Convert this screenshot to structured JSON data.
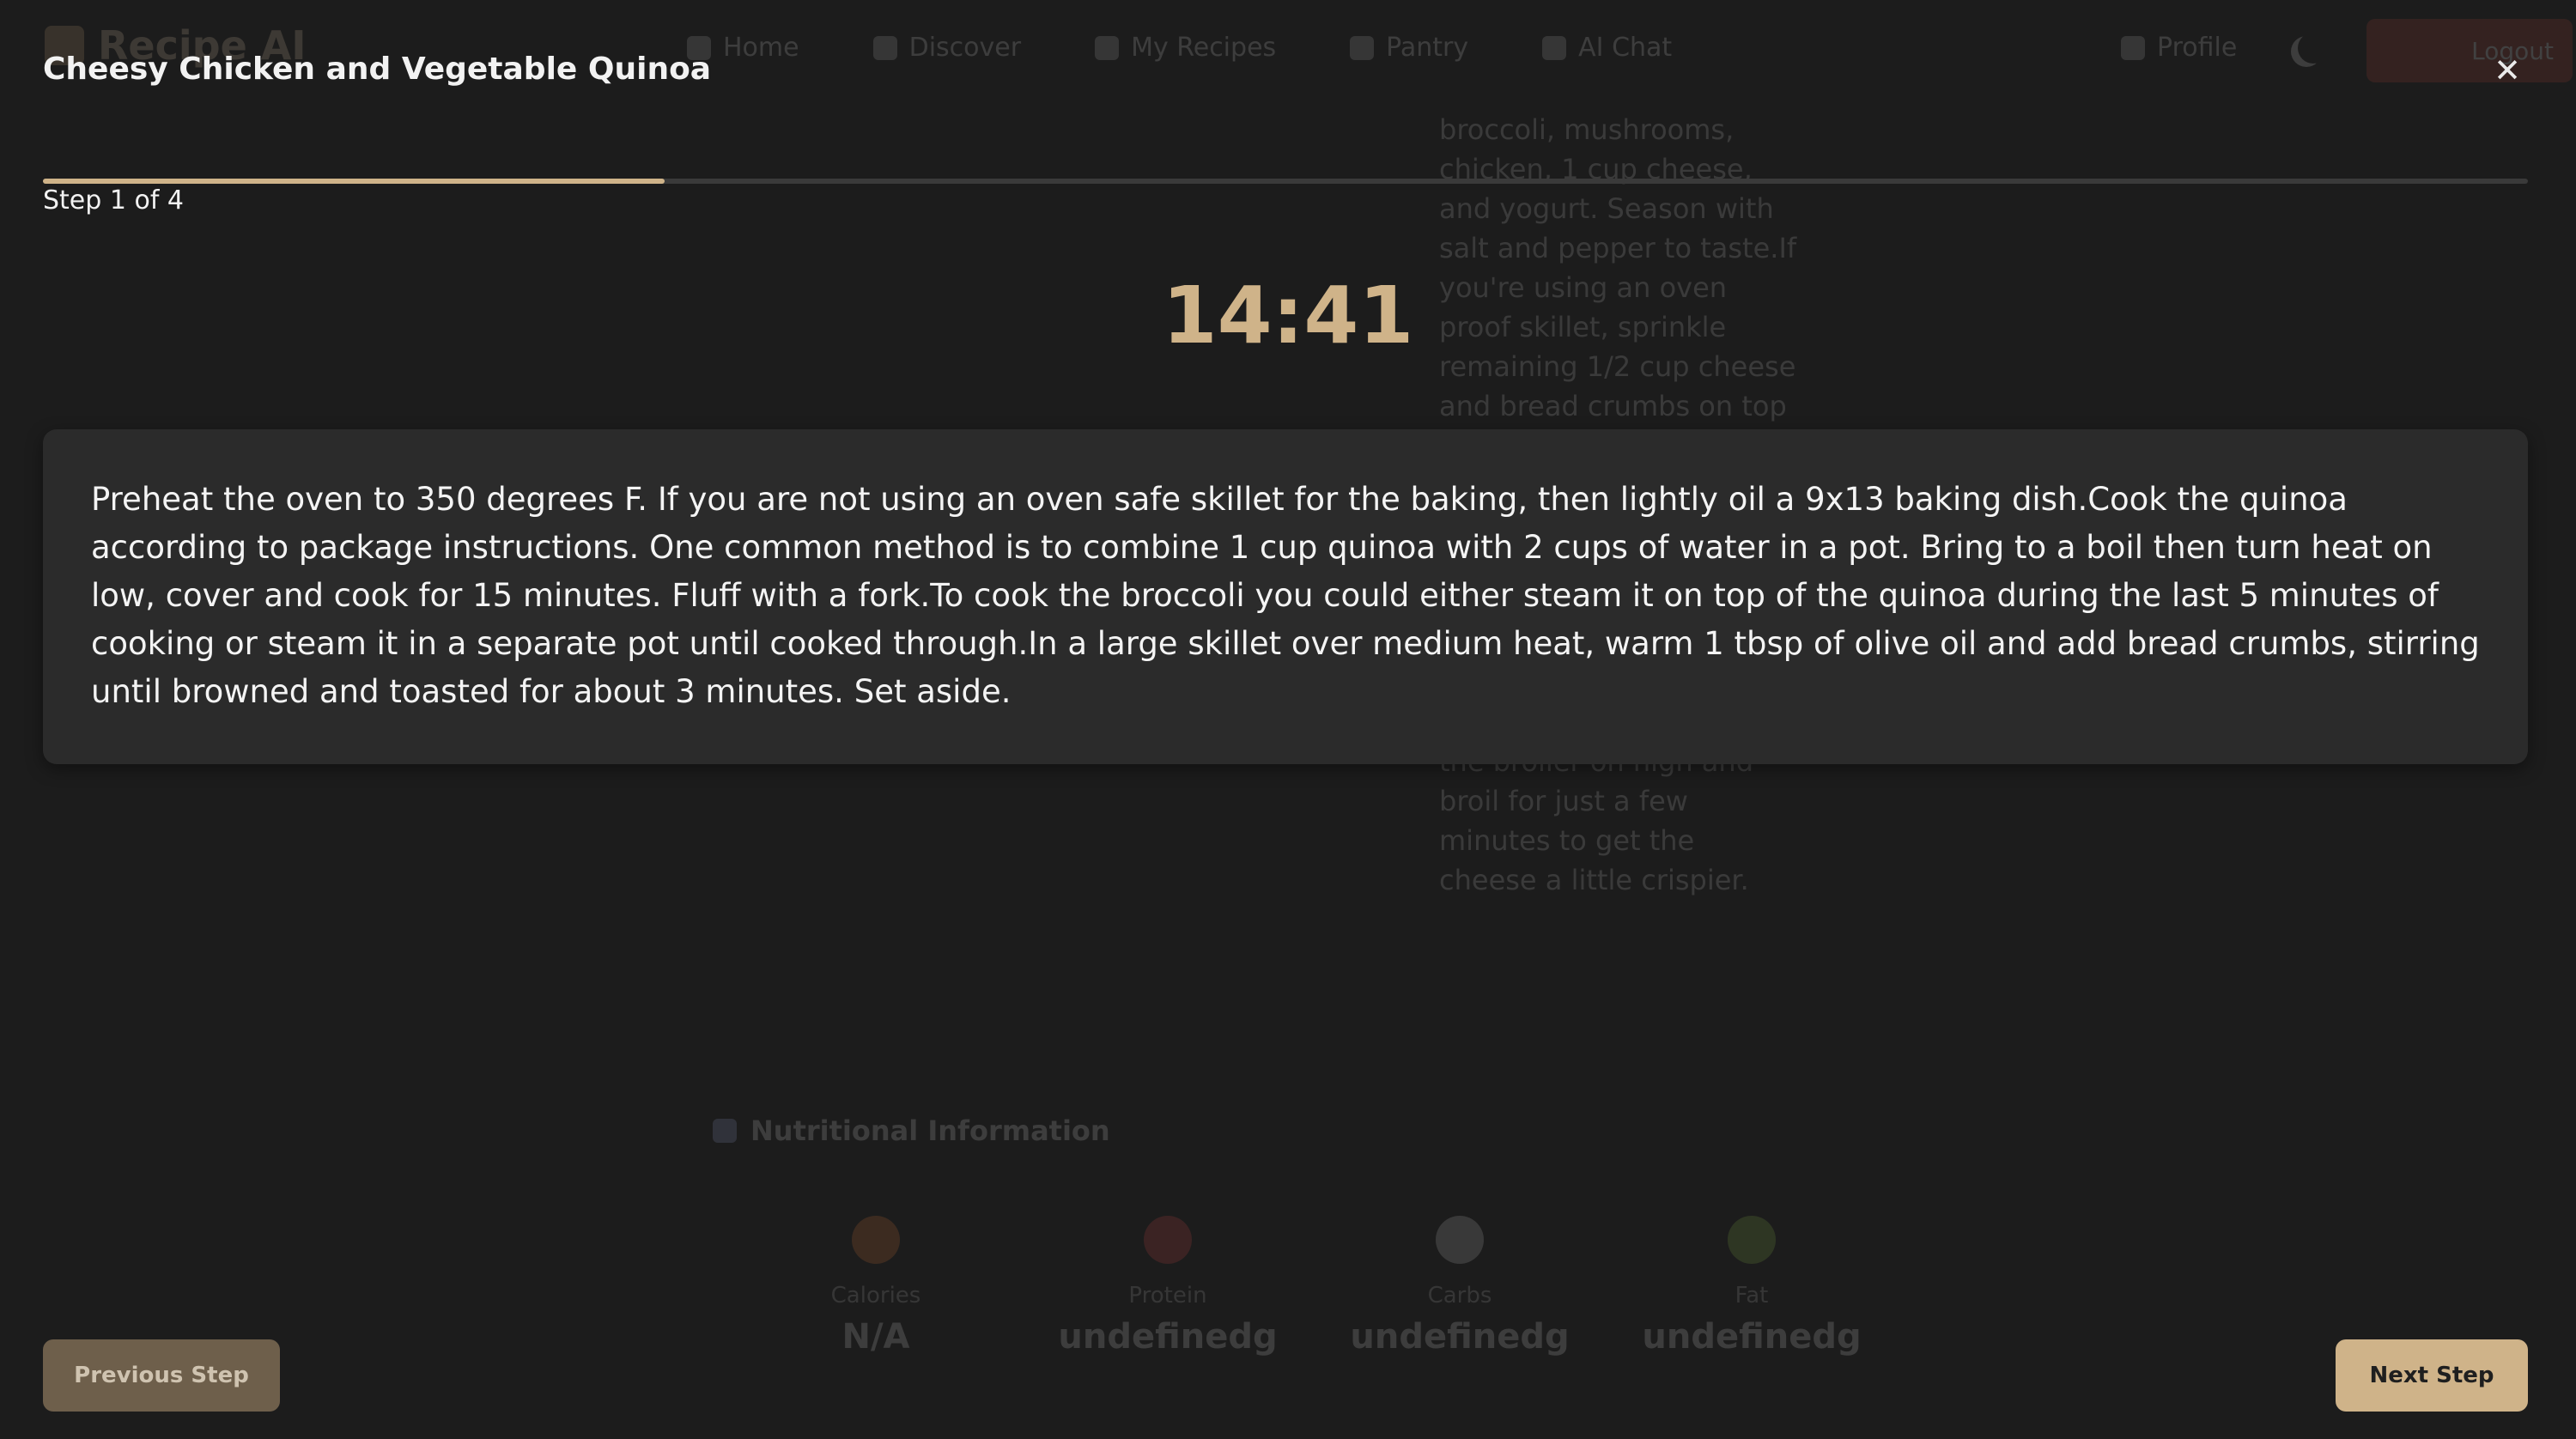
{
  "app": {
    "brand": "Recipe AI",
    "nav": [
      {
        "label": "Home",
        "icon": "home-icon"
      },
      {
        "label": "Discover",
        "icon": "search-icon"
      },
      {
        "label": "My Recipes",
        "icon": "book-icon"
      },
      {
        "label": "Pantry",
        "icon": "pantry-icon"
      },
      {
        "label": "AI Chat",
        "icon": "chat-icon"
      }
    ],
    "profile_label": "Profile",
    "logout_label": "Logout",
    "instructions_upper": "broccoli, mushrooms, chicken, 1 cup cheese, and yogurt. Season with salt and pepper to taste.If you're using an oven proof skillet, sprinkle remaining 1/2 cup cheese and bread crumbs on top of the",
    "instructions_lower": "the broiler on high and broil for just a few minutes to get the cheese a little crispier.",
    "nutrition": {
      "title": "Nutritional Information",
      "items": [
        {
          "label": "Calories",
          "value": "N/A",
          "icon": "flame-icon",
          "color": "#e07a3a"
        },
        {
          "label": "Protein",
          "value": "undefinedg",
          "icon": "steak-icon",
          "color": "#d94a4a"
        },
        {
          "label": "Carbs",
          "value": "undefinedg",
          "icon": "bread-icon",
          "color": "#cfcfcf"
        },
        {
          "label": "Fat",
          "value": "undefinedg",
          "icon": "avocado-icon",
          "color": "#8fbf4a"
        }
      ]
    }
  },
  "modal": {
    "title": "Cheesy Chicken and Vegetable Quinoa",
    "close_glyph": "✕",
    "step_label": "Step 1 of 4",
    "progress": 0.25,
    "timer": "14:41",
    "step_text": "Preheat the oven to 350 degrees F. If you are not using an oven safe skillet for the baking, then lightly oil a 9x13 baking dish.Cook the quinoa according to package instructions. One common method is to combine 1 cup quinoa with 2 cups of water in a pot. Bring to a boil then turn heat on low, cover and cook for 15 minutes. Fluff with a fork.To cook the broccoli you could either steam it on top of the quinoa during the last 5 minutes of cooking or steam it in a separate pot until cooked through.In a large skillet over medium heat, warm 1 tbsp of olive oil and add bread crumbs, stirring until browned and toasted for about 3 minutes. Set aside.",
    "prev_label": "Previous Step",
    "next_label": "Next Step",
    "accent": "#cfb389"
  }
}
